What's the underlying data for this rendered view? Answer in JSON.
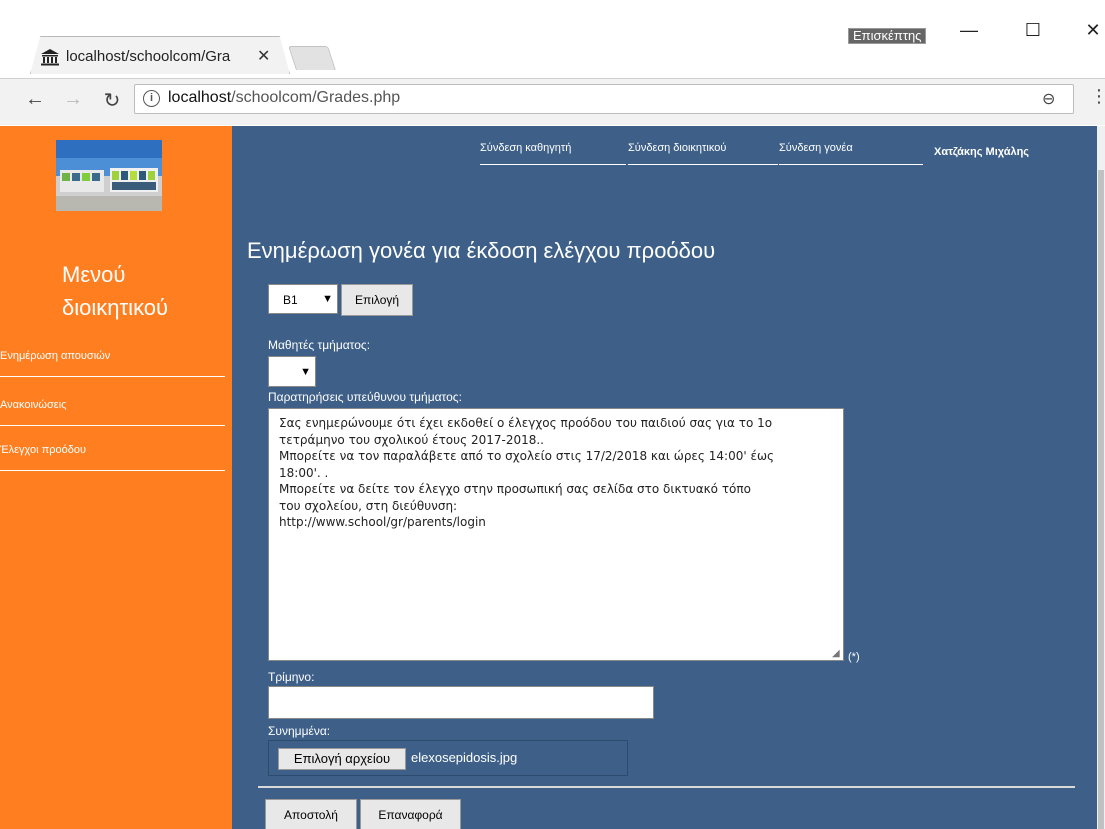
{
  "browser": {
    "tab_title": "localhost/schoolcom/Gra",
    "window_user": "Επισκέπτης",
    "url_host": "localhost",
    "url_path": "/schoolcom/Grades.php"
  },
  "topnav": {
    "teacher_login": "Σύνδεση καθηγητή",
    "admin_login": "Σύνδεση διοικητικού",
    "parent_login": "Σύνδεση γονέα",
    "user_name": "Χατζάκης Μιχάλης"
  },
  "sidebar": {
    "title": "Μενού διοικητικού",
    "items": [
      {
        "label": "Ενημέρωση απουσιών"
      },
      {
        "label": "Ανακοινώσεις"
      },
      {
        "label": "Έλεγχοι προόδου"
      }
    ]
  },
  "main": {
    "title": "Ενημέρωση γονέα για έκδοση ελέγχου προόδου",
    "class_select_value": "B1",
    "choose_label": "Επιλογή",
    "students_label": "Μαθητές τμήματος:",
    "student_select_value": "",
    "remarks_label": "Παρατηρήσεις υπεύθυνου τμήματος:",
    "remarks_text": "Σας ενημερώνουμε ότι έχει εκδοθεί ο έλεγχος προόδου του παιδιού σας για το 1ο\nτετράμηνο του σχολικού έτους 2017-2018..\nΜπορείτε να τον παραλάβετε από το σχολείο στις 17/2/2018 και ώρες 14:00' έως\n18:00'. .\nΜπορείτε να δείτε τον έλεγχο στην προσωπική σας σελίδα στο δικτυακό τόπο\nτου σχολείου, στη διεύθυνση:\nhttp://www.school/gr/parents/login",
    "required_mark": "(*)",
    "term_label": "Τρίμηνο:",
    "term_value": "",
    "attachments_label": "Συνημμένα:",
    "file_button_label": "Επιλογή αρχείου",
    "file_name": "elexosepidosis.jpg",
    "send_label": "Αποστολή",
    "reset_label": "Επαναφορά"
  },
  "icons": {
    "favicon": "bank-icon",
    "back": "arrow-left-icon",
    "forward": "arrow-right-icon",
    "reload": "reload-icon",
    "info": "info-icon",
    "zoom": "zoom-icon",
    "menu": "kebab-menu-icon"
  },
  "colors": {
    "sidebar": "#ff7f20",
    "content": "#3e6088"
  }
}
